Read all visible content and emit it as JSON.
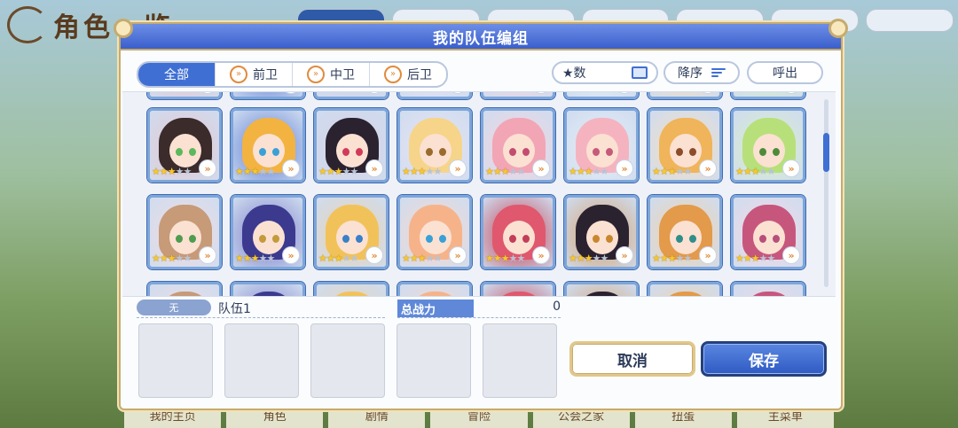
{
  "background": {
    "title": "角色一览",
    "bottom_tabs": [
      "我的主页",
      "角色",
      "剧情",
      "冒险",
      "公会之家",
      "扭蛋",
      "主菜单"
    ]
  },
  "dialog": {
    "title": "我的队伍编组",
    "tabs": [
      {
        "label": "全部",
        "active": true,
        "icon": ""
      },
      {
        "label": "前卫",
        "active": false,
        "icon": "position-front-icon"
      },
      {
        "label": "中卫",
        "active": false,
        "icon": "position-middle-icon"
      },
      {
        "label": "后卫",
        "active": false,
        "icon": "position-back-icon"
      }
    ],
    "sort_label": "★数",
    "order_label": "降序",
    "out_label": "呼出",
    "team_tag": "无",
    "team_name": "队伍1",
    "power_label": "总战力",
    "power_value": "0",
    "cancel_label": "取消",
    "save_label": "保存"
  },
  "characters": [
    [
      {
        "stars": 3,
        "hair": "#3b2b2b",
        "eye": "#5cb85c",
        "accent": "#e7c6cf"
      },
      {
        "stars": 3,
        "hair": "#f2b341",
        "eye": "#3aa0d8",
        "accent": "#5a7bd6"
      },
      {
        "stars": 3,
        "hair": "#2b2230",
        "eye": "#d13b5a",
        "accent": "#d7d2e6"
      },
      {
        "stars": 3,
        "hair": "#f6d48a",
        "eye": "#9a6b2d",
        "accent": "#e9e4f3"
      },
      {
        "stars": 3,
        "hair": "#f2a5b5",
        "eye": "#c24d6f",
        "accent": "#f7d4de"
      },
      {
        "stars": 3,
        "hair": "#f5b3c0",
        "eye": "#c65a79",
        "accent": "#e7eef7"
      },
      {
        "stars": 3,
        "hair": "#f0b45a",
        "eye": "#8b4d2a",
        "accent": "#f6dfc1"
      },
      {
        "stars": 3,
        "hair": "#b7e07a",
        "eye": "#4d8b3a",
        "accent": "#d9efc9"
      }
    ],
    [
      {
        "stars": 3,
        "hair": "#c79a78",
        "eye": "#4f9c4f",
        "accent": "#f2dce1"
      },
      {
        "stars": 3,
        "hair": "#3b3a8f",
        "eye": "#c49a3b",
        "accent": "#7a7cc9"
      },
      {
        "stars": 3,
        "hair": "#f2c25a",
        "eye": "#3a7fc9",
        "accent": "#ead3b0"
      },
      {
        "stars": 3,
        "hair": "#f6b38a",
        "eye": "#3aa0d8",
        "accent": "#f7d9cf"
      },
      {
        "stars": 3,
        "hair": "#e0586d",
        "eye": "#c23e5a",
        "accent": "#c43b4d"
      },
      {
        "stars": 3,
        "hair": "#2b2230",
        "eye": "#c9872d",
        "accent": "#d7a06a"
      },
      {
        "stars": 3,
        "hair": "#e39a4a",
        "eye": "#2f8e8a",
        "accent": "#f3d2a8"
      },
      {
        "stars": 3,
        "hair": "#c7567d",
        "eye": "#b74f7a",
        "accent": "#f5d9e4"
      }
    ]
  ]
}
